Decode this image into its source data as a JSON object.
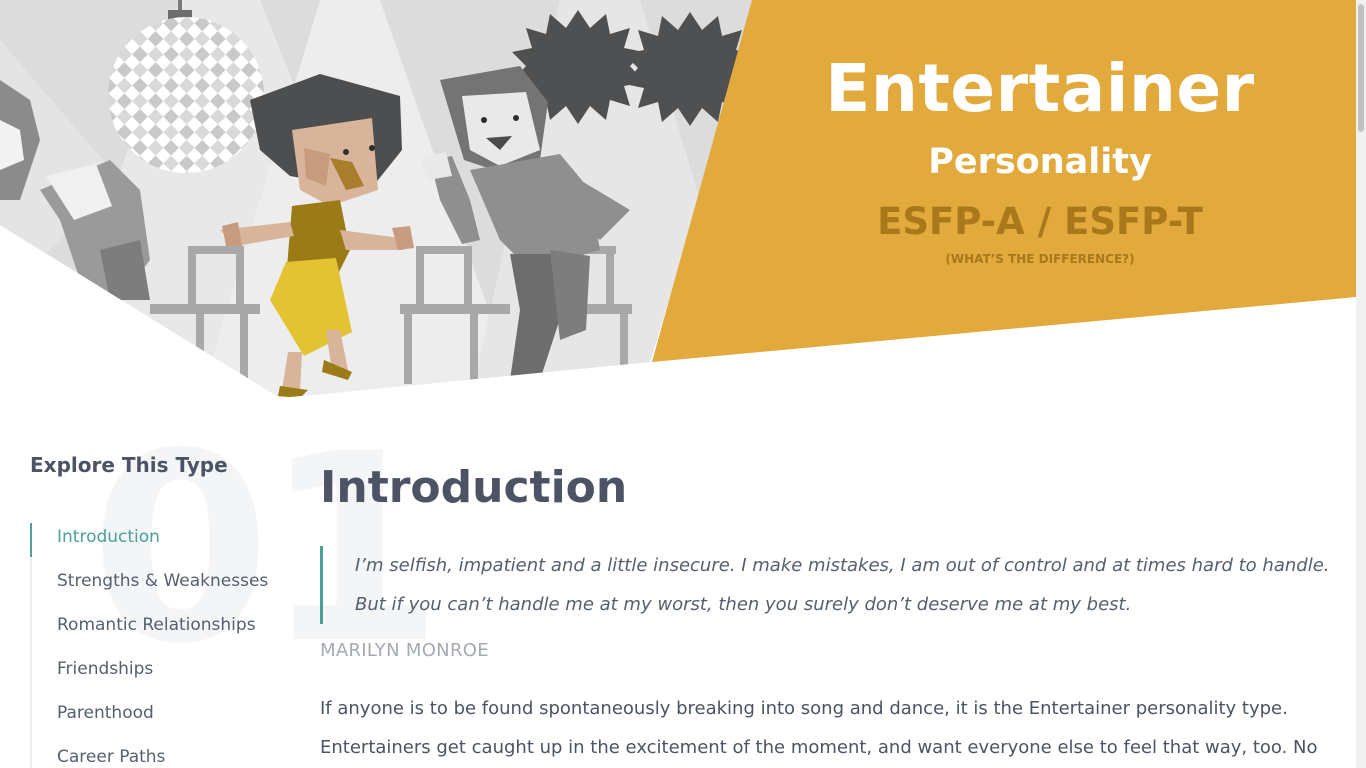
{
  "hero": {
    "title": "Entertainer",
    "subtitle": "Personality",
    "codes": "ESFP-A / ESFP-T",
    "difference_link": "(WHAT’S THE DIFFERENCE?)"
  },
  "sidebar": {
    "title": "Explore This Type",
    "section_number": "01",
    "items": [
      {
        "label": "Introduction",
        "active": true
      },
      {
        "label": "Strengths & Weaknesses"
      },
      {
        "label": "Romantic Relationships"
      },
      {
        "label": "Friendships"
      },
      {
        "label": "Parenthood"
      },
      {
        "label": "Career Paths"
      }
    ]
  },
  "main": {
    "heading": "Introduction",
    "quote": "I’m selfish, impatient and a little insecure. I make mistakes, I am out of control and at times hard to handle. But if you can’t handle me at my worst, then you surely don’t deserve me at my best.",
    "quote_author": "MARILYN MONROE",
    "body": "If anyone is to be found spontaneously breaking into song and dance, it is the Entertainer personality type. Entertainers get caught up in the excitement of the moment, and want everyone else to feel that way, too. No"
  },
  "colors": {
    "accent": "#4ba097",
    "hero_gold": "#e2a93d",
    "hero_code": "#a8781a"
  }
}
